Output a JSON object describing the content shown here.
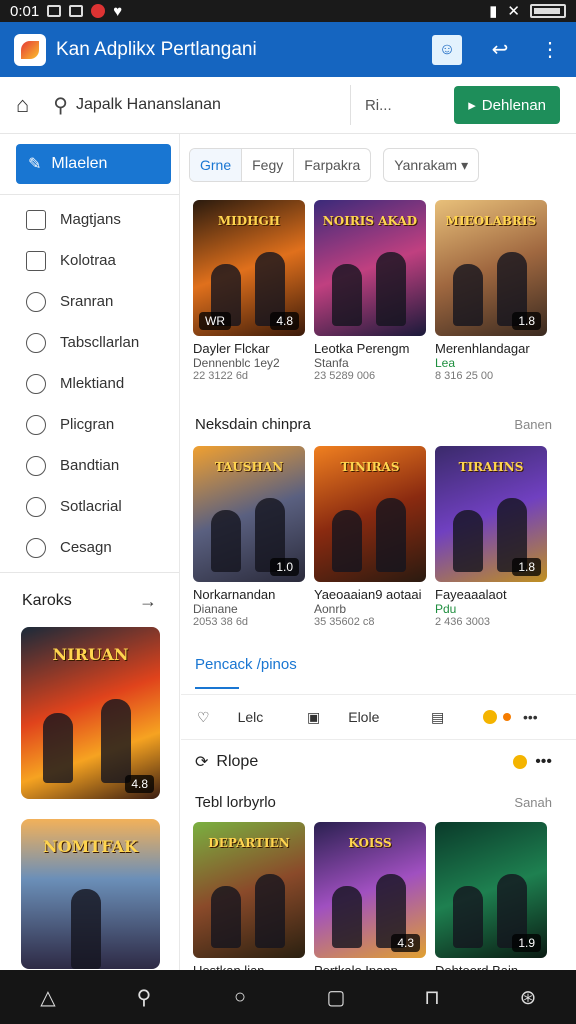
{
  "status": {
    "time": "0:01"
  },
  "app": {
    "title": "Kan Adplikx Pertlangani"
  },
  "toolbar": {
    "search_placeholder": "Japalk Hananslanan",
    "more_label": "Ri...",
    "cta_label": "Dehlenan"
  },
  "sidebar": {
    "primary_label": "Mlaelen",
    "items": [
      {
        "label": "Magtjans",
        "icon": "grid-icon"
      },
      {
        "label": "Kolotraa",
        "icon": "corner-icon"
      },
      {
        "label": "Sranran",
        "icon": "pencil-icon"
      },
      {
        "label": "Tabscllarlan",
        "icon": "plus-circle-icon"
      },
      {
        "label": "Mlektiand",
        "icon": "info-icon"
      },
      {
        "label": "Plicgran",
        "icon": "search-icon"
      },
      {
        "label": "Bandtian",
        "icon": "leaf-icon"
      },
      {
        "label": "Sotlacrial",
        "icon": "chat-icon"
      },
      {
        "label": "Cesagn",
        "icon": "smile-icon"
      }
    ],
    "section_title": "Karoks",
    "cards": [
      {
        "title": "NIRUAN",
        "rating": "4.8"
      },
      {
        "title": "NOMTFAK",
        "rating": ""
      }
    ]
  },
  "filters": {
    "segments": [
      "Grne",
      "Fegy",
      "Farpakra"
    ],
    "dropdown": "Yanrakam"
  },
  "row1": [
    {
      "title": "MIDHGH",
      "name": "Dayler Flckar",
      "sub": "Dennenblc 1ey2",
      "meta": "22 3122 6d",
      "rating": "4.8",
      "badge": "WR"
    },
    {
      "title": "NOIRIS AKAD",
      "name": "Leotka Perengm",
      "sub": "Stanfa",
      "meta": "23 5289 006",
      "rating": ""
    },
    {
      "title": "MIEOLABRIS",
      "name": "Merenhlandagar",
      "sub": "Lea",
      "meta": "8 316 25 00",
      "rating": "1.8"
    }
  ],
  "section2": {
    "title": "Neksdain chinpra",
    "see_all": "Banen"
  },
  "row2": [
    {
      "title": "TAUSHAN",
      "name": "Norkarnandan",
      "sub": "Dianane",
      "meta": "2053 38 6d",
      "rating": "1.0"
    },
    {
      "title": "TINIRAS",
      "name": "Yaeoaaian9 aotaai",
      "sub": "Aonrb",
      "meta": "35 35602 c8",
      "rating": ""
    },
    {
      "title": "TIRAHNS",
      "name": "Fayeaaalaot",
      "sub": "Pdu",
      "meta": "2 436 3003",
      "rating": "1.8"
    }
  ],
  "tab": {
    "label": "Pencack /pinos"
  },
  "actions": {
    "like": "Lelc",
    "edit": "Elole"
  },
  "section3": {
    "title": "Rlope"
  },
  "section4": {
    "title": "Tebl lorbyrlo",
    "see_all": "Sanah"
  },
  "row3": [
    {
      "title": "DEPARTIEN",
      "name": "Uestkan lian",
      "rating": ""
    },
    {
      "title": "KOISS",
      "name": "Pertkalo Ipanp",
      "rating": "4.3"
    },
    {
      "title": "",
      "name": "Dehtoord Bain",
      "rating": "1.9"
    }
  ]
}
